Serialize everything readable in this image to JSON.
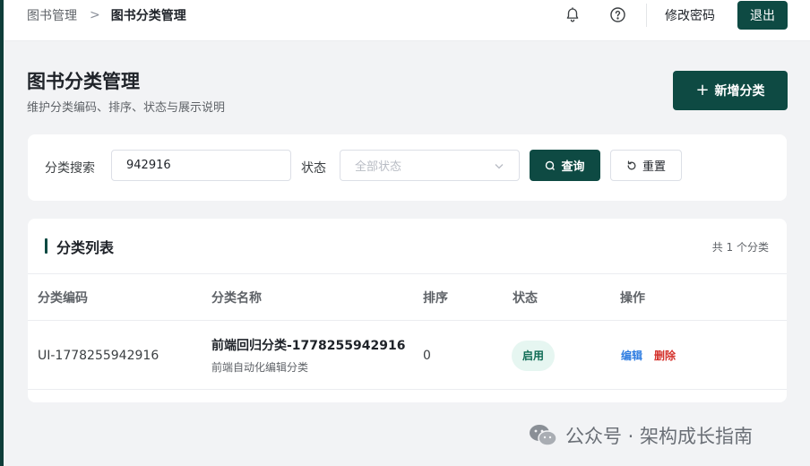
{
  "breadcrumb": {
    "parent": "图书管理",
    "separator": ">",
    "current": "图书分类管理"
  },
  "topbar": {
    "bell_icon": "bell-icon",
    "help_icon": "question-circle-icon",
    "change_password": "修改密码",
    "logout": "退出"
  },
  "header": {
    "title": "图书分类管理",
    "subtitle": "维护分类编码、排序、状态与展示说明",
    "add_button": "新增分类",
    "add_icon": "plus-icon"
  },
  "filter": {
    "search_label": "分类搜索",
    "search_value": "942916",
    "status_label": "状态",
    "status_placeholder": "全部状态",
    "query_button": "查询",
    "reset_button": "重置"
  },
  "list": {
    "title": "分类列表",
    "count": "共 1 个分类",
    "columns": [
      "分类编码",
      "分类名称",
      "排序",
      "状态",
      "操作"
    ],
    "rows": [
      {
        "code": "UI-1778255942916",
        "name": "前端回归分类-1778255942916",
        "description": "前端自动化编辑分类",
        "sort": "0",
        "status": "启用",
        "edit": "编辑",
        "delete": "删除"
      }
    ]
  },
  "watermark": {
    "text": "公众号 · 架构成长指南",
    "icon": "wechat-icon"
  },
  "colors": {
    "primary": "#0e4a43",
    "link": "#2f7de1",
    "danger": "#d4322c",
    "badge_bg": "#e6f6f1",
    "page_bg": "#f2f3f5"
  }
}
